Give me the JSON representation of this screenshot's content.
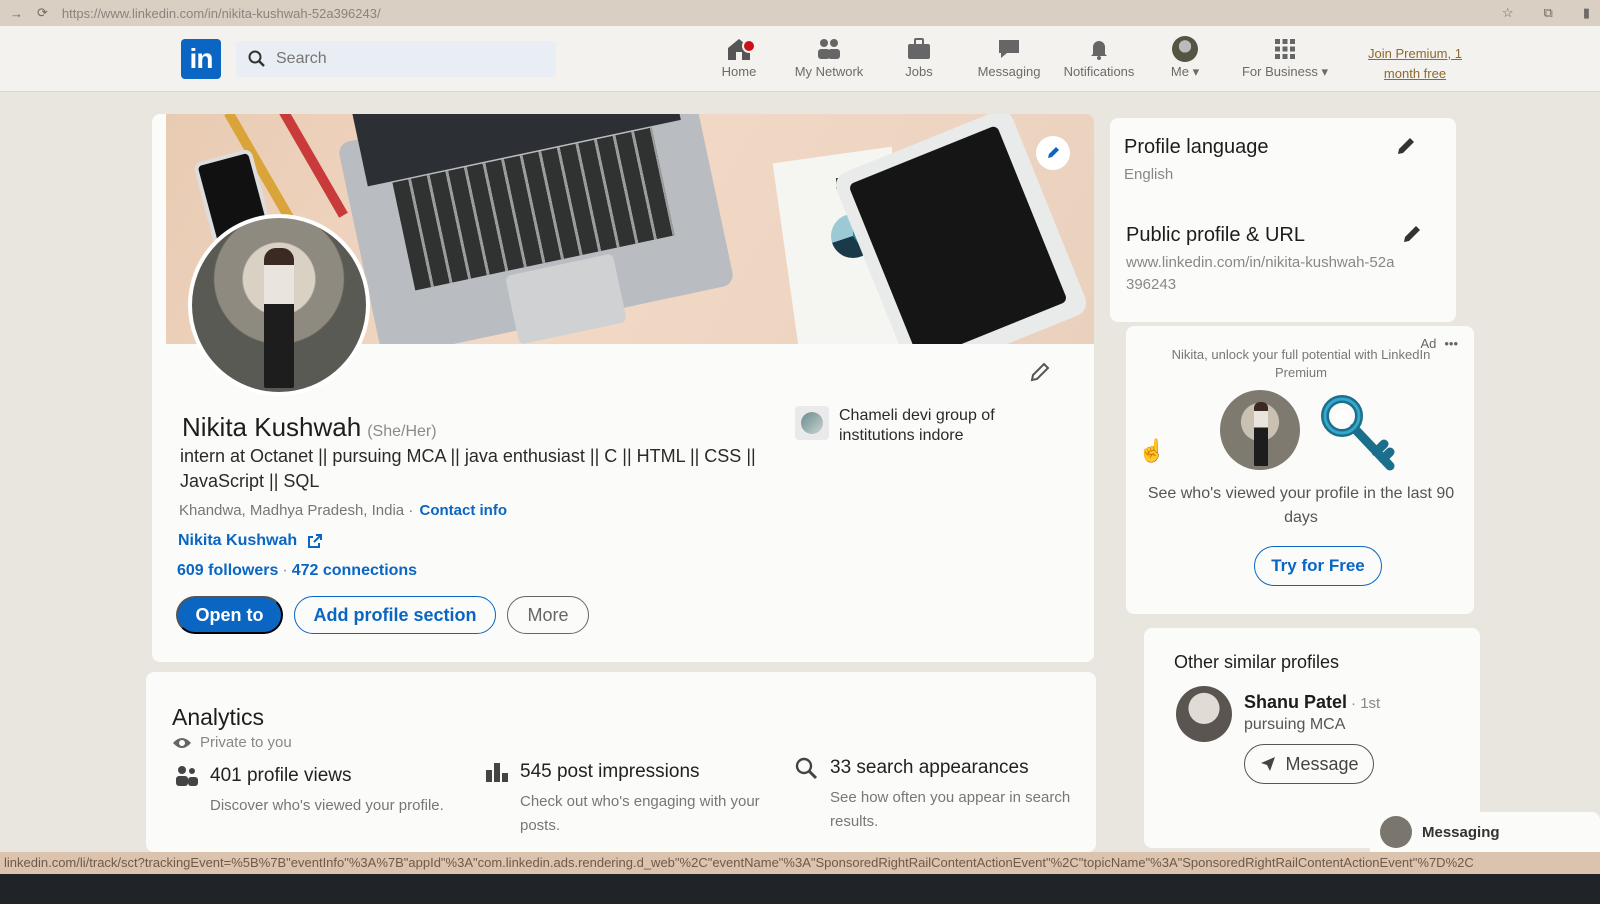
{
  "browser": {
    "url": "https://www.linkedin.com/in/nikita-kushwah-52a396243/"
  },
  "nav": {
    "logo": "in",
    "search_placeholder": "Search",
    "items": [
      {
        "label": "Home",
        "icon": "home-icon"
      },
      {
        "label": "My Network",
        "icon": "network-icon"
      },
      {
        "label": "Jobs",
        "icon": "briefcase-icon"
      },
      {
        "label": "Messaging",
        "icon": "chat-icon"
      },
      {
        "label": "Notifications",
        "icon": "bell-icon"
      },
      {
        "label": "Me",
        "icon": "avatar-icon"
      },
      {
        "label": "For Business",
        "icon": "grid-icon"
      }
    ],
    "premium": "Join Premium, 1 month free"
  },
  "profile": {
    "banner_text": "ML",
    "name": "Nikita Kushwah",
    "pronouns": "(She/Her)",
    "headline": "intern at Octanet || pursuing MCA || java enthusiast || C || HTML || CSS || JavaScript || SQL",
    "location": "Khandwa, Madhya Pradesh, India",
    "location_sep": "·",
    "contact_info": "Contact info",
    "website": "Nikita Kushwah",
    "followers": "609 followers",
    "connections_sep": "·",
    "connections": "472 connections",
    "buttons": {
      "open_to": "Open to",
      "add_section": "Add profile section",
      "more": "More"
    },
    "education": "Chameli devi group of institutions indore"
  },
  "analytics": {
    "title": "Analytics",
    "private": "Private to you",
    "items": [
      {
        "title": "401 profile views",
        "desc": "Discover who's viewed your profile."
      },
      {
        "title": "545 post impressions",
        "desc": "Check out who's engaging with your posts."
      },
      {
        "title": "33 search appearances",
        "desc": "See how often you appear in search results."
      }
    ]
  },
  "right_rail": {
    "profile_language": {
      "title": "Profile language",
      "value": "English"
    },
    "public_profile": {
      "title": "Public profile & URL",
      "value": "www.linkedin.com/in/nikita-kushwah-52a396243"
    },
    "ad": {
      "label": "Ad",
      "more": "•••",
      "text": "Nikita, unlock your full potential with LinkedIn Premium",
      "body": "See who's viewed your profile in the last 90 days",
      "button": "Try for Free"
    },
    "similar": {
      "title": "Other similar profiles",
      "name": "Shanu Patel",
      "degree": "· 1st",
      "headline": "pursuing MCA",
      "button": "Message"
    },
    "messaging_tab": "Messaging"
  },
  "status_bar": "linkedin.com/li/track/sct?trackingEvent=%5B%7B\"eventInfo\"%3A%7B\"appId\"%3A\"com.linkedin.ads.rendering.d_web\"%2C\"eventName\"%3A\"SponsoredRightRailContentActionEvent\"%2C\"topicName\"%3A\"SponsoredRightRailContentActionEvent\"%7D%2C"
}
